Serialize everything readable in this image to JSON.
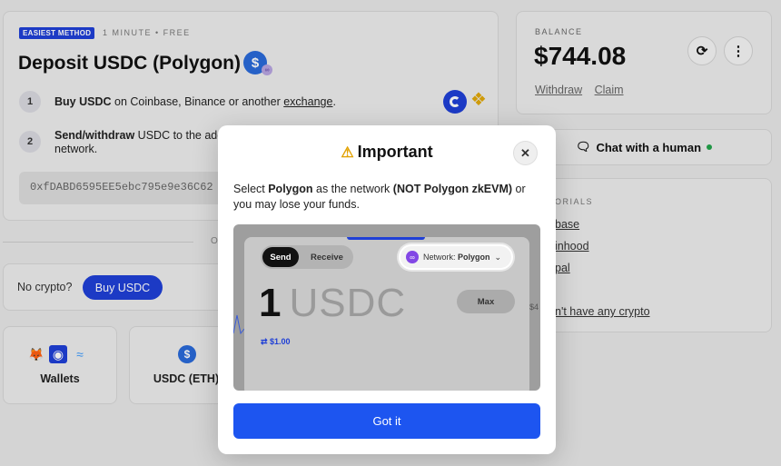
{
  "deposit": {
    "badge": "EASIEST METHOD",
    "meta": "1 MINUTE • FREE",
    "title": "Deposit USDC (Polygon)",
    "step1": {
      "num": "1",
      "bold": "Buy USDC",
      "text": " on Coinbase, Binance or another ",
      "link": "exchange",
      "end": "."
    },
    "step2": {
      "num": "2",
      "bold": "Send/withdraw",
      "text": " USDC to the add",
      "line2": "network."
    },
    "address": "0xfDABD6595EE5ebc795e9e36C62"
  },
  "balance": {
    "label": "BALANCE",
    "value": "$744.08",
    "withdraw": "Withdraw",
    "claim": "Claim",
    "refresh_icon": "refresh-icon",
    "more_icon": "more-icon"
  },
  "chat": {
    "label": "Chat with a human",
    "status_color": "#22a34a"
  },
  "tutorials": {
    "label": "ORIALS",
    "links": [
      "base",
      "inhood",
      "pal",
      "n't have any crypto"
    ]
  },
  "or_text": "O",
  "nocrypto": {
    "text": "No crypto?",
    "button": "Buy USDC"
  },
  "tiles": {
    "wallets": "Wallets",
    "usdc_eth": "USDC (ETH)"
  },
  "modal": {
    "title": "Important",
    "intro": "Select ",
    "net1": "Polygon",
    "mid": " as the network ",
    "net2": "(NOT Polygon zkEVM)",
    "tail": " or you may lose your funds.",
    "preview": {
      "send": "Send",
      "receive": "Receive",
      "network_prefix": "Network: ",
      "network": "Polygon",
      "amount_num": "1",
      "amount_unit": "USDC",
      "max": "Max",
      "usd": "⇄ $1.00",
      "side_text": "$4"
    },
    "button": "Got it"
  },
  "colors": {
    "accent": "#1f3fd6",
    "button_blue": "#1d55f0"
  }
}
